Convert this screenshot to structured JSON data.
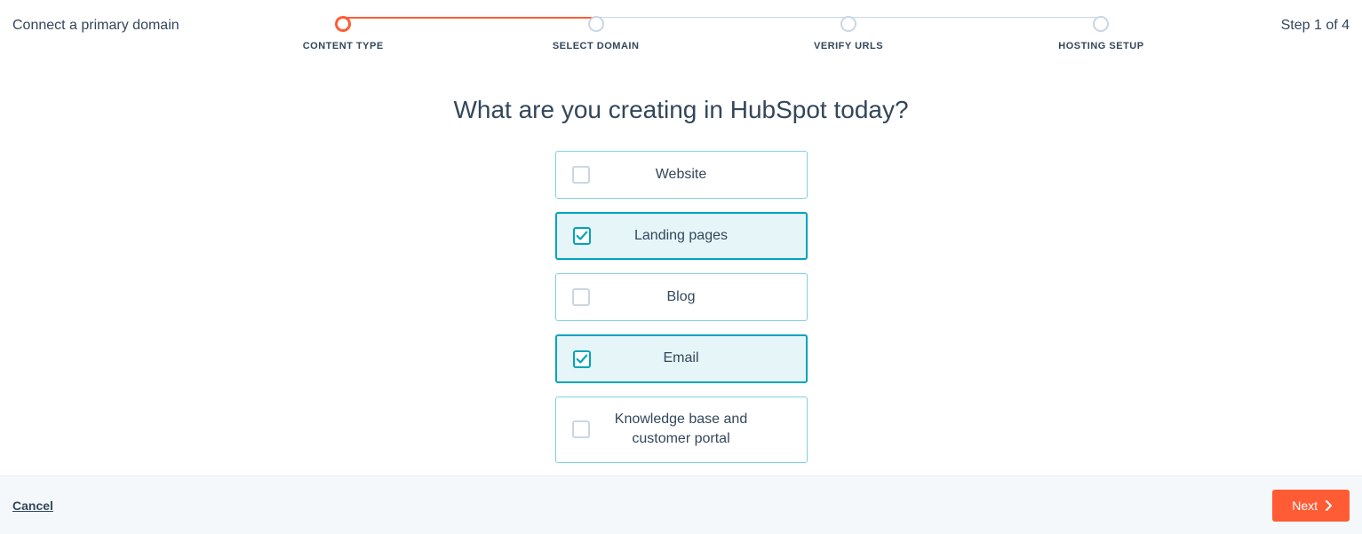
{
  "header": {
    "title": "Connect a primary domain",
    "step_text": "Step 1 of 4"
  },
  "stepper": {
    "steps": [
      {
        "label": "CONTENT TYPE",
        "active": true
      },
      {
        "label": "SELECT DOMAIN",
        "active": false
      },
      {
        "label": "VERIFY URLS",
        "active": false
      },
      {
        "label": "HOSTING SETUP",
        "active": false
      }
    ]
  },
  "main": {
    "heading": "What are you creating in HubSpot today?",
    "options": [
      {
        "label": "Website",
        "selected": false
      },
      {
        "label": "Landing pages",
        "selected": true
      },
      {
        "label": "Blog",
        "selected": false
      },
      {
        "label": "Email",
        "selected": true
      },
      {
        "label": "Knowledge base and customer portal",
        "selected": false
      }
    ]
  },
  "footer": {
    "cancel_label": "Cancel",
    "next_label": "Next"
  }
}
